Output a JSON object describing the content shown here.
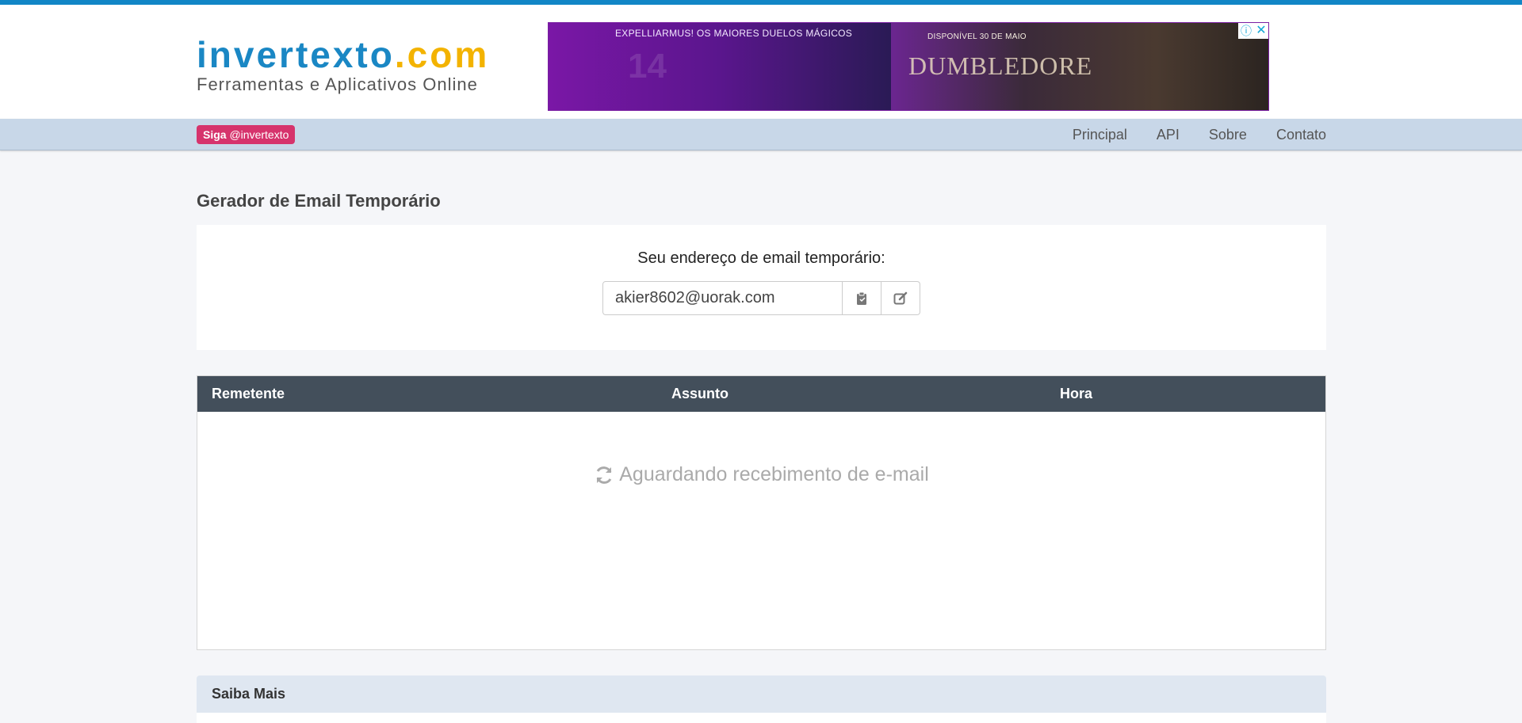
{
  "header": {
    "logo_brand": "invertexto",
    "logo_tld": ".com",
    "logo_subtitle": "Ferramentas e Aplicativos Online"
  },
  "ad": {
    "left_text": "EXPELLIARMUS! OS MAIORES DUELOS MÁGICOS",
    "right_text": "DISPONÍVEL 30 DE MAIO",
    "title": "DUMBLEDORE",
    "info_icon": "info-icon",
    "close_icon": "close-icon"
  },
  "nav": {
    "follow_prefix": "Siga",
    "follow_handle": "@invertexto",
    "links": [
      "Principal",
      "API",
      "Sobre",
      "Contato"
    ]
  },
  "main": {
    "page_title": "Gerador de Email Temporário",
    "email_label": "Seu endereço de email temporário:",
    "email_value": "akier8602@uorak.com",
    "copy_icon": "clipboard-icon",
    "edit_icon": "edit-icon"
  },
  "table": {
    "columns": [
      "Remetente",
      "Assunto",
      "Hora"
    ],
    "waiting_text": "Aguardando recebimento de e-mail",
    "waiting_icon": "refresh-icon"
  },
  "saiba": {
    "title": "Saiba Mais"
  },
  "colors": {
    "accent": "#1186c6",
    "logo_tld": "#f3b300",
    "follow_badge": "#d6336c",
    "table_header": "#434f5b",
    "nav_bg": "#c8d7e8"
  }
}
